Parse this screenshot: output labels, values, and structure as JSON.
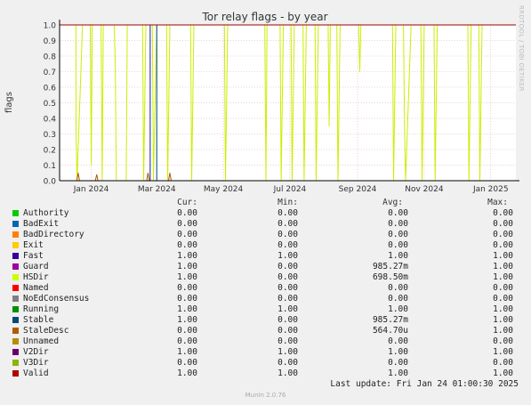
{
  "title": "Tor relay flags - by year",
  "ylabel": "flags",
  "credit": "RRDTOOL / TOBI OETIKER",
  "version": "Munin 2.0.76",
  "last_update": "Last update: Fri Jan 24 01:00:30 2025",
  "headers": {
    "cur": "Cur:",
    "min": "Min:",
    "avg": "Avg:",
    "max": "Max:"
  },
  "colors": {
    "plot_bg": "#ffffff",
    "grid": "#e8a0a0",
    "axis": "#000000",
    "hsdir_line": "#ccee00",
    "valid_line": "#a00000"
  },
  "chart_data": {
    "type": "line",
    "title": "Tor relay flags - by year",
    "ylabel": "flags",
    "xlabel": "",
    "ylim": [
      0,
      1
    ],
    "y_ticks": [
      "0.0",
      "0.1",
      "0.2",
      "0.3",
      "0.4",
      "0.5",
      "0.6",
      "0.7",
      "0.8",
      "0.9",
      "1.0"
    ],
    "x_ticks": [
      "Jan 2024",
      "Mar 2024",
      "May 2024",
      "Jul 2024",
      "Sep 2024",
      "Nov 2024",
      "Jan 2025"
    ],
    "x_range": [
      "2023-12-03",
      "2025-01-24"
    ],
    "grid": true,
    "series": [
      {
        "name": "Valid",
        "color": "#a00000",
        "constant": 1.0
      },
      {
        "name": "Stable",
        "color": "#005c66",
        "constant": 1.0
      },
      {
        "name": "Fast",
        "color": "#1a1a9a",
        "constant": 1.0
      },
      {
        "name": "Running",
        "color": "#1f8a1f",
        "constant": 1.0
      },
      {
        "name": "HSDir",
        "color": "#ccee00",
        "note_points": [
          [
            "2023-12-03",
            1.0
          ],
          [
            "2023-12-18",
            1.0
          ],
          [
            "2023-12-18",
            0.35
          ],
          [
            "2023-12-19",
            0.0
          ],
          [
            "2023-12-24",
            1.0
          ],
          [
            "2023-12-31",
            1.0
          ],
          [
            "2024-01-01",
            0.1
          ],
          [
            "2024-01-02",
            1.0
          ],
          [
            "2024-01-10",
            1.0
          ],
          [
            "2024-01-11",
            0.0
          ],
          [
            "2024-01-12",
            1.0
          ],
          [
            "2024-01-22",
            1.0
          ],
          [
            "2024-01-23",
            0.75
          ],
          [
            "2024-01-24",
            0.0
          ],
          [
            "2024-02-02",
            0.0
          ],
          [
            "2024-02-03",
            1.0
          ],
          [
            "2024-02-17",
            1.0
          ],
          [
            "2024-02-18",
            0.0
          ],
          [
            "2024-02-20",
            1.0
          ],
          [
            "2024-02-26",
            1.0
          ],
          [
            "2024-02-27",
            0.0
          ],
          [
            "2024-03-01",
            1.0
          ],
          [
            "2024-03-10",
            1.0
          ],
          [
            "2024-03-11",
            0.0
          ],
          [
            "2024-03-13",
            1.0
          ],
          [
            "2024-04-01",
            1.0
          ],
          [
            "2024-04-02",
            0.0
          ],
          [
            "2024-04-04",
            1.0
          ],
          [
            "2024-05-02",
            1.0
          ],
          [
            "2024-05-03",
            0.0
          ],
          [
            "2024-05-05",
            1.0
          ],
          [
            "2024-06-08",
            1.0
          ],
          [
            "2024-06-09",
            0.0
          ],
          [
            "2024-06-10",
            1.0
          ],
          [
            "2024-06-22",
            1.0
          ],
          [
            "2024-06-23",
            0.0
          ],
          [
            "2024-06-25",
            1.0
          ],
          [
            "2024-07-02",
            1.0
          ],
          [
            "2024-07-03",
            0.0
          ],
          [
            "2024-07-05",
            1.0
          ],
          [
            "2024-07-13",
            1.0
          ],
          [
            "2024-07-14",
            0.0
          ],
          [
            "2024-07-16",
            1.0
          ],
          [
            "2024-07-24",
            1.0
          ],
          [
            "2024-07-25",
            0.0
          ],
          [
            "2024-07-27",
            1.0
          ],
          [
            "2024-08-05",
            1.0
          ],
          [
            "2024-08-06",
            0.35
          ],
          [
            "2024-08-07",
            1.0
          ],
          [
            "2024-08-13",
            1.0
          ],
          [
            "2024-08-14",
            0.0
          ],
          [
            "2024-08-16",
            1.0
          ],
          [
            "2024-09-02",
            1.0
          ],
          [
            "2024-09-03",
            0.7
          ],
          [
            "2024-09-04",
            1.0
          ],
          [
            "2024-10-03",
            1.0
          ],
          [
            "2024-10-04",
            0.0
          ],
          [
            "2024-10-06",
            1.0
          ],
          [
            "2024-10-13",
            1.0
          ],
          [
            "2024-10-14",
            0.35
          ],
          [
            "2024-10-15",
            0.0
          ],
          [
            "2024-10-20",
            1.0
          ],
          [
            "2024-10-29",
            1.0
          ],
          [
            "2024-10-30",
            0.0
          ],
          [
            "2024-11-01",
            1.0
          ],
          [
            "2024-11-10",
            1.0
          ],
          [
            "2024-11-11",
            0.0
          ],
          [
            "2024-11-13",
            1.0
          ],
          [
            "2024-12-11",
            1.0
          ],
          [
            "2024-12-12",
            0.0
          ],
          [
            "2024-12-14",
            1.0
          ],
          [
            "2024-12-21",
            1.0
          ],
          [
            "2024-12-22",
            0.0
          ],
          [
            "2024-12-24",
            1.0
          ],
          [
            "2025-01-24",
            1.0
          ]
        ]
      },
      {
        "name": "StaleDesc",
        "color": "#b05800",
        "spikes": [
          [
            "2023-12-20",
            0.05
          ],
          [
            "2024-01-06",
            0.04
          ],
          [
            "2024-02-22",
            0.05
          ],
          [
            "2024-03-13",
            0.05
          ]
        ]
      },
      {
        "name": "Authority",
        "color": "#00cc00",
        "constant": 0.0
      },
      {
        "name": "BadExit",
        "color": "#0066b3",
        "constant": 0.0
      },
      {
        "name": "BadDirectory",
        "color": "#ff8000",
        "constant": 0.0
      },
      {
        "name": "Exit",
        "color": "#ffcc00",
        "constant": 0.0
      },
      {
        "name": "Guard",
        "color": "#990099",
        "constant": 1.0
      },
      {
        "name": "Named",
        "color": "#ff0000",
        "constant": 0.0
      },
      {
        "name": "NoEdConsensus",
        "color": "#66aa33",
        "constant": 0.0
      },
      {
        "name": "Unnamed",
        "color": "#b8860b",
        "constant": 0.0
      },
      {
        "name": "V2Dir",
        "color": "#4b0082",
        "constant": 1.0
      },
      {
        "name": "V3Dir",
        "color": "#99b31a",
        "constant": 0.0
      }
    ],
    "gaps": [
      [
        "2024-02-24",
        "2024-03-01"
      ]
    ]
  },
  "legend": [
    {
      "name": "Authority",
      "color": "#00cc00",
      "cur": "0.00",
      "min": "0.00",
      "avg": "0.00",
      "max": "0.00"
    },
    {
      "name": "BadExit",
      "color": "#0066b3",
      "cur": "0.00",
      "min": "0.00",
      "avg": "0.00",
      "max": "0.00"
    },
    {
      "name": "BadDirectory",
      "color": "#ff8000",
      "cur": "0.00",
      "min": "0.00",
      "avg": "0.00",
      "max": "0.00"
    },
    {
      "name": "Exit",
      "color": "#ffcc00",
      "cur": "0.00",
      "min": "0.00",
      "avg": "0.00",
      "max": "0.00"
    },
    {
      "name": "Fast",
      "color": "#330099",
      "cur": "1.00",
      "min": "1.00",
      "avg": "1.00",
      "max": "1.00"
    },
    {
      "name": "Guard",
      "color": "#990099",
      "cur": "1.00",
      "min": "0.00",
      "avg": "985.27m",
      "max": "1.00"
    },
    {
      "name": "HSDir",
      "color": "#ccff00",
      "cur": "1.00",
      "min": "0.00",
      "avg": "698.50m",
      "max": "1.00"
    },
    {
      "name": "Named",
      "color": "#ff0000",
      "cur": "0.00",
      "min": "0.00",
      "avg": "0.00",
      "max": "0.00"
    },
    {
      "name": "NoEdConsensus",
      "color": "#808080",
      "cur": "0.00",
      "min": "0.00",
      "avg": "0.00",
      "max": "0.00"
    },
    {
      "name": "Running",
      "color": "#008f00",
      "cur": "1.00",
      "min": "1.00",
      "avg": "1.00",
      "max": "1.00"
    },
    {
      "name": "Stable",
      "color": "#00487d",
      "cur": "1.00",
      "min": "0.00",
      "avg": "985.27m",
      "max": "1.00"
    },
    {
      "name": "StaleDesc",
      "color": "#b35a00",
      "cur": "0.00",
      "min": "0.00",
      "avg": "564.70u",
      "max": "1.00"
    },
    {
      "name": "Unnamed",
      "color": "#b38f00",
      "cur": "0.00",
      "min": "0.00",
      "avg": "0.00",
      "max": "0.00"
    },
    {
      "name": "V2Dir",
      "color": "#6b006b",
      "cur": "1.00",
      "min": "1.00",
      "avg": "1.00",
      "max": "1.00"
    },
    {
      "name": "V3Dir",
      "color": "#8fb300",
      "cur": "0.00",
      "min": "0.00",
      "avg": "0.00",
      "max": "0.00"
    },
    {
      "name": "Valid",
      "color": "#b30000",
      "cur": "1.00",
      "min": "1.00",
      "avg": "1.00",
      "max": "1.00"
    }
  ]
}
